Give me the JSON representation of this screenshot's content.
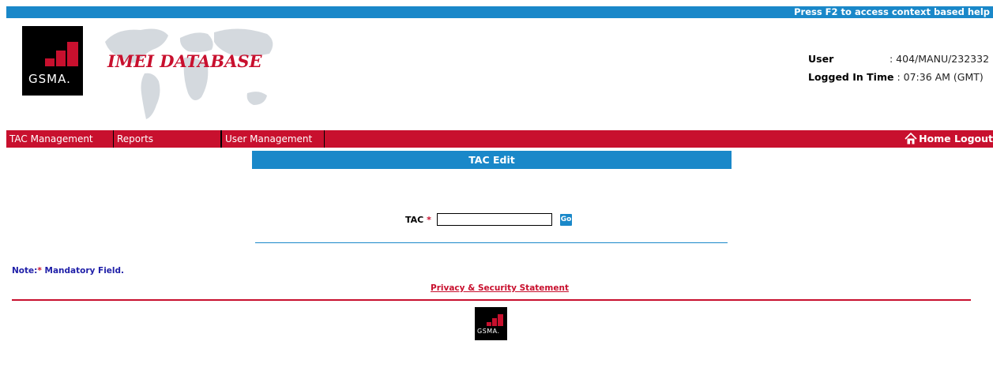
{
  "top_bar": {
    "help_text": "Press F2 to access context based help"
  },
  "header": {
    "logo_text": "GSMA.",
    "app_title": "IMEI DATABASE",
    "user_label": "User",
    "user_value": ": 404/MANU/232332",
    "login_time_label": "Logged In Time",
    "login_time_value": ": 07:36 AM (GMT)"
  },
  "nav": {
    "items": [
      {
        "label": "TAC Management"
      },
      {
        "label": "Reports"
      },
      {
        "label": "User Management"
      }
    ],
    "home_label": "Home",
    "logout_label": "Logout"
  },
  "panel": {
    "title": "TAC Edit"
  },
  "form": {
    "tac_label": "TAC",
    "required_marker": "*",
    "tac_value": "",
    "go_label": "Go"
  },
  "note": {
    "prefix": "Note:",
    "marker": "*",
    "text": " Mandatory Field."
  },
  "footer": {
    "privacy_link": "Privacy & Security Statement",
    "logo_text": "GSMA."
  },
  "colors": {
    "primary_blue": "#1a88c9",
    "brand_red": "#c8102e"
  },
  "icons": {
    "home": "home-icon"
  }
}
